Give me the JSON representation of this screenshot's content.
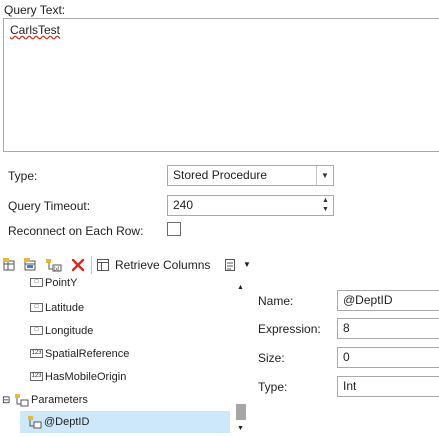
{
  "query": {
    "label": "Query Text:",
    "text": "CarlsTest"
  },
  "type": {
    "label": "Type:",
    "value": "Stored Procedure"
  },
  "timeout": {
    "label": "Query Timeout:",
    "value": "240"
  },
  "reconnect": {
    "label": "Reconnect on Each Row:",
    "checked": false
  },
  "toolbar": {
    "retrieve_label": "Retrieve Columns"
  },
  "tree": {
    "items": [
      {
        "label": "PointY",
        "icon": "field-icon"
      },
      {
        "label": "Latitude",
        "icon": "field-icon"
      },
      {
        "label": "Longitude",
        "icon": "field-icon"
      },
      {
        "label": "SpatialReference",
        "icon": "numeric-field-icon"
      },
      {
        "label": "HasMobileOrigin",
        "icon": "numeric-field-icon"
      },
      {
        "label": "Parameters",
        "icon": "parameters-icon"
      },
      {
        "label": "@DeptID",
        "icon": "parameter-icon"
      }
    ]
  },
  "props": {
    "name_label": "Name:",
    "name_value": "@DeptID",
    "expression_label": "Expression:",
    "expression_value": "8",
    "size_label": "Size:",
    "size_value": "0",
    "type_label": "Type:",
    "type_value": "Int"
  },
  "colors": {
    "selected_row": "#cde8fa",
    "delete_icon": "#d52b1e",
    "border": "#a9a9a9"
  }
}
